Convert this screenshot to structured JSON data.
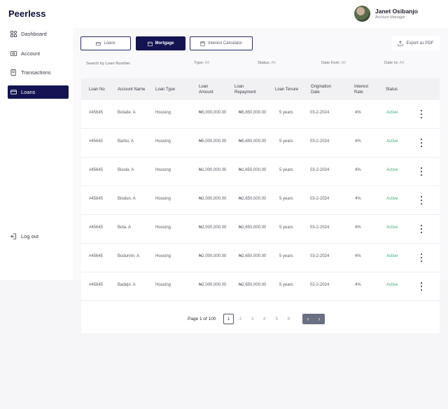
{
  "brand": "Peerless",
  "user": {
    "name": "Janet Osibanjo",
    "role": "Account Manager"
  },
  "sidebar": {
    "items": [
      {
        "label": "Dashboard",
        "icon": "grid-icon"
      },
      {
        "label": "Account",
        "icon": "wallet-icon"
      },
      {
        "label": "Transactions",
        "icon": "document-icon"
      },
      {
        "label": "Loans",
        "icon": "loan-icon",
        "active": true
      }
    ],
    "logout": "Log out"
  },
  "tabs": [
    {
      "label": "Loans",
      "icon": "loan-icon"
    },
    {
      "label": "Mortgage",
      "icon": "calendar-icon",
      "active": true
    },
    {
      "label": "Interest Calculator",
      "icon": "calculator-icon"
    }
  ],
  "export_label": "Export as PDF",
  "filters": {
    "search_placeholder": "Search by Loan Number.",
    "type_label": "Type:",
    "type_value": "All",
    "status_label": "Status:",
    "status_value": "All",
    "date_from_label": "Date from:",
    "date_from_value": "All",
    "date_to_label": "Date to:",
    "date_to_value": "All"
  },
  "table": {
    "headers": [
      "Loan No",
      "Account Name",
      "Loan Type",
      "Loan Amount",
      "Loan Repayment",
      "Loan Tenure",
      "Origination Date",
      "Interest Rate",
      "Status"
    ],
    "rows": [
      [
        "#45645",
        "Bolade. A",
        "Housing",
        "₦5,000,000.00",
        "₦5,650,000.00",
        "5 years",
        "03-2-2024",
        "4%",
        "Active"
      ],
      [
        "#45645",
        "Barbu. A",
        "Housing",
        "₦5,000,000.00",
        "₦5,650,000.00",
        "5 years",
        "03-2-2024",
        "4%",
        "Active"
      ],
      [
        "#45645",
        "Bisola. A",
        "Housing",
        "₦1,000,000.00",
        "₦1,650,000.00",
        "5 years",
        "03-2-2024",
        "4%",
        "Active"
      ],
      [
        "#45645",
        "Biodun. A",
        "Housing",
        "₦2,000,000.00",
        "₦2,650,000.00",
        "5 years",
        "03-2-2024",
        "4%",
        "Active"
      ],
      [
        "#45645",
        "Bola. A",
        "Housing",
        "₦2,000,000.00",
        "₦2,650,000.00",
        "5 years",
        "03-2-2024",
        "4%",
        "Active"
      ],
      [
        "#45645",
        "Bodunrin. A",
        "Housing",
        "₦2,000,000.00",
        "₦2,650,000.00",
        "5 years",
        "03-2-2024",
        "4%",
        "Active"
      ],
      [
        "#45645",
        "Badejo. A",
        "Housing",
        "₦2,000,000.00",
        "₦2,650,000.00",
        "5 years",
        "02-2-2024",
        "4%",
        "Active"
      ]
    ]
  },
  "pagination": {
    "label": "Page 1 of 100",
    "pages": [
      "1",
      "2",
      "3",
      "4",
      "5",
      "6"
    ],
    "prev": "‹",
    "next": "›"
  },
  "colors": {
    "primary": "#141452",
    "active_status": "#2fb87a"
  }
}
